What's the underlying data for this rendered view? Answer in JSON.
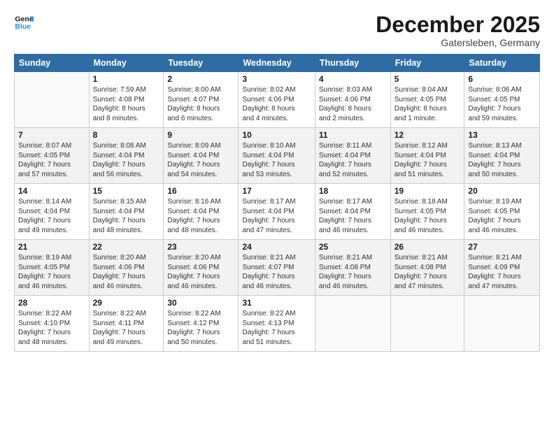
{
  "logo": {
    "line1": "General",
    "line2": "Blue"
  },
  "title": "December 2025",
  "subtitle": "Gatersleben, Germany",
  "days_of_week": [
    "Sunday",
    "Monday",
    "Tuesday",
    "Wednesday",
    "Thursday",
    "Friday",
    "Saturday"
  ],
  "weeks": [
    [
      {
        "day": "",
        "info": ""
      },
      {
        "day": "1",
        "info": "Sunrise: 7:59 AM\nSunset: 4:08 PM\nDaylight: 8 hours\nand 8 minutes."
      },
      {
        "day": "2",
        "info": "Sunrise: 8:00 AM\nSunset: 4:07 PM\nDaylight: 8 hours\nand 6 minutes."
      },
      {
        "day": "3",
        "info": "Sunrise: 8:02 AM\nSunset: 4:06 PM\nDaylight: 8 hours\nand 4 minutes."
      },
      {
        "day": "4",
        "info": "Sunrise: 8:03 AM\nSunset: 4:06 PM\nDaylight: 8 hours\nand 2 minutes."
      },
      {
        "day": "5",
        "info": "Sunrise: 8:04 AM\nSunset: 4:05 PM\nDaylight: 8 hours\nand 1 minute."
      },
      {
        "day": "6",
        "info": "Sunrise: 8:06 AM\nSunset: 4:05 PM\nDaylight: 7 hours\nand 59 minutes."
      }
    ],
    [
      {
        "day": "7",
        "info": "Sunrise: 8:07 AM\nSunset: 4:05 PM\nDaylight: 7 hours\nand 57 minutes."
      },
      {
        "day": "8",
        "info": "Sunrise: 8:08 AM\nSunset: 4:04 PM\nDaylight: 7 hours\nand 56 minutes."
      },
      {
        "day": "9",
        "info": "Sunrise: 8:09 AM\nSunset: 4:04 PM\nDaylight: 7 hours\nand 54 minutes."
      },
      {
        "day": "10",
        "info": "Sunrise: 8:10 AM\nSunset: 4:04 PM\nDaylight: 7 hours\nand 53 minutes."
      },
      {
        "day": "11",
        "info": "Sunrise: 8:11 AM\nSunset: 4:04 PM\nDaylight: 7 hours\nand 52 minutes."
      },
      {
        "day": "12",
        "info": "Sunrise: 8:12 AM\nSunset: 4:04 PM\nDaylight: 7 hours\nand 51 minutes."
      },
      {
        "day": "13",
        "info": "Sunrise: 8:13 AM\nSunset: 4:04 PM\nDaylight: 7 hours\nand 50 minutes."
      }
    ],
    [
      {
        "day": "14",
        "info": "Sunrise: 8:14 AM\nSunset: 4:04 PM\nDaylight: 7 hours\nand 49 minutes."
      },
      {
        "day": "15",
        "info": "Sunrise: 8:15 AM\nSunset: 4:04 PM\nDaylight: 7 hours\nand 48 minutes."
      },
      {
        "day": "16",
        "info": "Sunrise: 8:16 AM\nSunset: 4:04 PM\nDaylight: 7 hours\nand 48 minutes."
      },
      {
        "day": "17",
        "info": "Sunrise: 8:17 AM\nSunset: 4:04 PM\nDaylight: 7 hours\nand 47 minutes."
      },
      {
        "day": "18",
        "info": "Sunrise: 8:17 AM\nSunset: 4:04 PM\nDaylight: 7 hours\nand 46 minutes."
      },
      {
        "day": "19",
        "info": "Sunrise: 8:18 AM\nSunset: 4:05 PM\nDaylight: 7 hours\nand 46 minutes."
      },
      {
        "day": "20",
        "info": "Sunrise: 8:19 AM\nSunset: 4:05 PM\nDaylight: 7 hours\nand 46 minutes."
      }
    ],
    [
      {
        "day": "21",
        "info": "Sunrise: 8:19 AM\nSunset: 4:05 PM\nDaylight: 7 hours\nand 46 minutes."
      },
      {
        "day": "22",
        "info": "Sunrise: 8:20 AM\nSunset: 4:06 PM\nDaylight: 7 hours\nand 46 minutes."
      },
      {
        "day": "23",
        "info": "Sunrise: 8:20 AM\nSunset: 4:06 PM\nDaylight: 7 hours\nand 46 minutes."
      },
      {
        "day": "24",
        "info": "Sunrise: 8:21 AM\nSunset: 4:07 PM\nDaylight: 7 hours\nand 46 minutes."
      },
      {
        "day": "25",
        "info": "Sunrise: 8:21 AM\nSunset: 4:08 PM\nDaylight: 7 hours\nand 46 minutes."
      },
      {
        "day": "26",
        "info": "Sunrise: 8:21 AM\nSunset: 4:08 PM\nDaylight: 7 hours\nand 47 minutes."
      },
      {
        "day": "27",
        "info": "Sunrise: 8:21 AM\nSunset: 4:09 PM\nDaylight: 7 hours\nand 47 minutes."
      }
    ],
    [
      {
        "day": "28",
        "info": "Sunrise: 8:22 AM\nSunset: 4:10 PM\nDaylight: 7 hours\nand 48 minutes."
      },
      {
        "day": "29",
        "info": "Sunrise: 8:22 AM\nSunset: 4:11 PM\nDaylight: 7 hours\nand 49 minutes."
      },
      {
        "day": "30",
        "info": "Sunrise: 8:22 AM\nSunset: 4:12 PM\nDaylight: 7 hours\nand 50 minutes."
      },
      {
        "day": "31",
        "info": "Sunrise: 8:22 AM\nSunset: 4:13 PM\nDaylight: 7 hours\nand 51 minutes."
      },
      {
        "day": "",
        "info": ""
      },
      {
        "day": "",
        "info": ""
      },
      {
        "day": "",
        "info": ""
      }
    ]
  ]
}
